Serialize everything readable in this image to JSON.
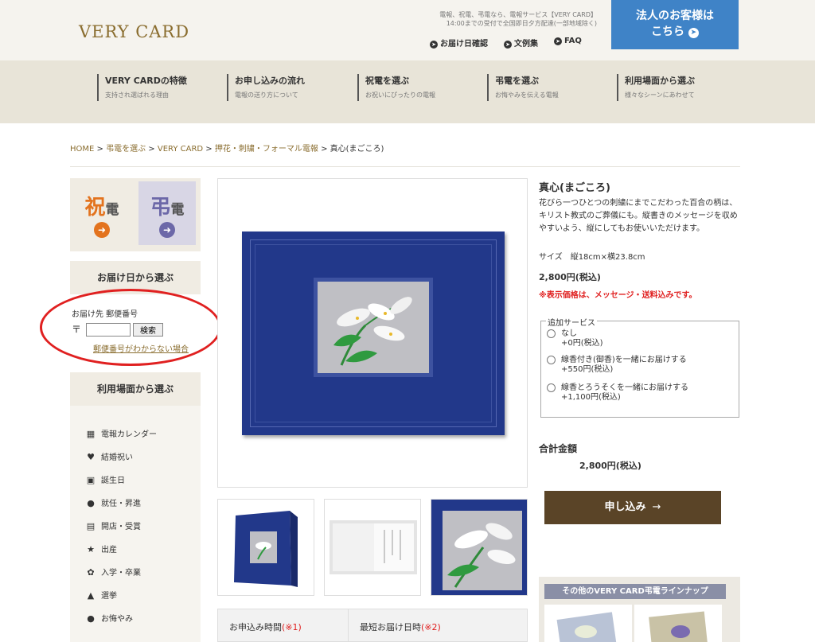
{
  "header": {
    "logo": "VERY CARD",
    "tagline_1": "電報、祝電、弔電なら、電報サービス【VERY CARD】",
    "tagline_2": "14:00までの受付で全国即日夕方配達(一部地域除く)",
    "links": [
      "お届け日確認",
      "文例集",
      "FAQ"
    ],
    "corporate_button_line1": "法人のお客様は",
    "corporate_button_line2": "こちら"
  },
  "nav": [
    {
      "title": "VERY CARDの特徴",
      "sub": "支持され選ばれる理由"
    },
    {
      "title": "お申し込みの流れ",
      "sub": "電報の送り方について"
    },
    {
      "title": "祝電を選ぶ",
      "sub": "お祝いにぴったりの電報"
    },
    {
      "title": "弔電を選ぶ",
      "sub": "お悔やみを伝える電報"
    },
    {
      "title": "利用場面から選ぶ",
      "sub": "様々なシーンにあわせて"
    }
  ],
  "breadcrumb": {
    "items": [
      "HOME",
      "弔電を選ぶ",
      "VERY CARD",
      "押花・刺繍・フォーマル電報"
    ],
    "separator": ">",
    "current": "真心(まごころ)"
  },
  "sidebar": {
    "cat_shuku_big": "祝",
    "cat_shuku_small": "電",
    "cat_cho_big": "弔",
    "cat_cho_small": "電",
    "delivery_heading": "お届け日から選ぶ",
    "postal_label": "お届け先 郵便番号",
    "postal_mark": "〒",
    "postal_value": "",
    "search_button": "検索",
    "postal_unknown_link": "郵便番号がわからない場合",
    "scene_heading": "利用場面から選ぶ",
    "scenes": [
      {
        "label": "電報カレンダー",
        "icon": "calendar-icon"
      },
      {
        "label": "結婚祝い",
        "icon": "heart-icon"
      },
      {
        "label": "誕生日",
        "icon": "gift-icon"
      },
      {
        "label": "就任・昇進",
        "icon": "people-icon"
      },
      {
        "label": "開店・受賞",
        "icon": "shop-icon"
      },
      {
        "label": "出産",
        "icon": "baby-icon"
      },
      {
        "label": "入学・卒業",
        "icon": "sakura-icon"
      },
      {
        "label": "選挙",
        "icon": "megaphone-icon"
      },
      {
        "label": "お悔やみ",
        "icon": "drop-icon"
      }
    ]
  },
  "product": {
    "title": "真心(まごころ)",
    "description": "花びら一つひとつの刺繍にまでこだわった百合の柄は、キリスト教式のご葬儀にも。縦書きのメッセージを収めやすいよう、縦にしてもお使いいただけます。",
    "size": "サイズ　縦18cm×横23.8cm",
    "price": "2,800円(税込)",
    "price_note": "※表示価格は、メッセージ・送料込みです。",
    "options_legend": "追加サービス",
    "options": [
      {
        "name": "なし",
        "price": "+0円(税込)"
      },
      {
        "name": "線香付き(御香)を一緒にお届けする",
        "price": "+550円(税込)"
      },
      {
        "name": "線香とろうそくを一緒にお届けする",
        "price": "+1,100円(税込)"
      }
    ],
    "total_label": "合計金額",
    "total_value": "2,800円(税込)",
    "apply_button": "申し込み",
    "lineup_heading": "その他のVERY CARD弔電ラインナップ"
  },
  "time_table": {
    "col1": "お申込み時間",
    "col1_note": "(※1)",
    "col2": "最短お届け日時",
    "col2_note": "(※2)"
  },
  "colors": {
    "accent_blue": "#3f83c7",
    "brand_gold": "#8a6d2f",
    "shuku_orange": "#e3731e",
    "cho_purple": "#6c68a8",
    "apply_brown": "#5a4427",
    "highlight_red": "#e02020"
  }
}
